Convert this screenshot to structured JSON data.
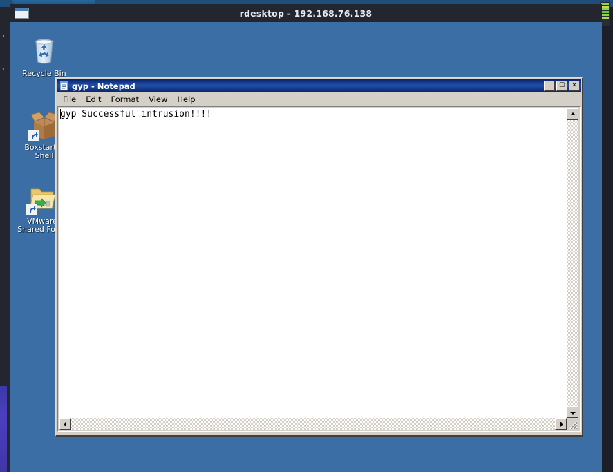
{
  "rdesktop": {
    "title": "rdesktop - 192.168.76.138",
    "icon_name": "window-icon"
  },
  "desktop": {
    "background_color": "#3a6ea5",
    "icons": [
      {
        "label": "Recycle Bin",
        "icon": "recycle-bin-icon",
        "shortcut": false
      },
      {
        "label": "Boxstarter Shell",
        "icon": "cardboard-box-icon",
        "shortcut": true
      },
      {
        "label": "VMware Shared Folde",
        "icon": "shared-folder-icon",
        "shortcut": true
      }
    ]
  },
  "notepad": {
    "title": "gyp - Notepad",
    "icon_name": "notepad-icon",
    "titlebar_color": "#0a246a",
    "controls": {
      "minimize": "_",
      "maximize": "☐",
      "close": "✕"
    },
    "menu": [
      {
        "label": "File"
      },
      {
        "label": "Edit"
      },
      {
        "label": "Format"
      },
      {
        "label": "View"
      },
      {
        "label": "Help"
      }
    ],
    "document_text": "gyp Successful intrusion!!!!",
    "scrollbars": {
      "vertical_up": "▲",
      "vertical_down": "▼",
      "horizontal_left": "◀",
      "horizontal_right": "▶"
    }
  }
}
